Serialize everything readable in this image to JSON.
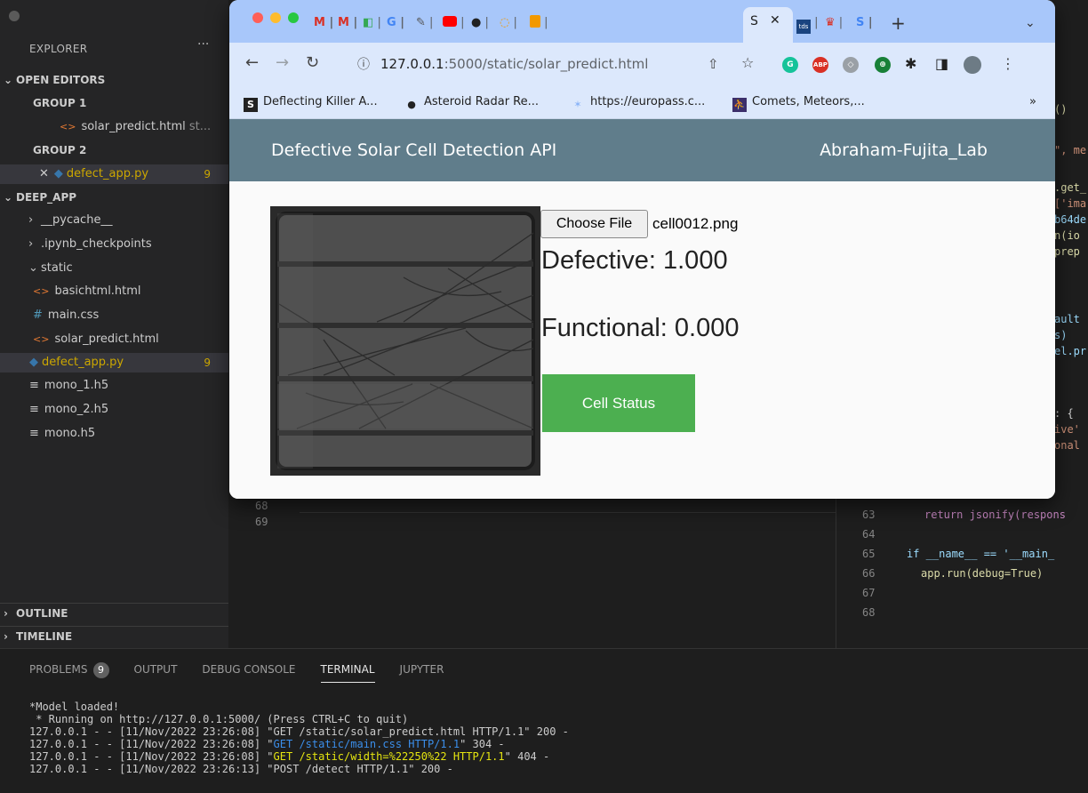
{
  "sidebar": {
    "title": "EXPLORER",
    "more": "···",
    "open_editors": "OPEN EDITORS",
    "group1": "GROUP 1",
    "group1_file": "solar_predict.html",
    "group1_file_suffix": "st...",
    "group2": "GROUP 2",
    "group2_file": "defect_app.py",
    "group2_badge": "9",
    "folder": "DEEP_APP",
    "items": [
      {
        "label": "__pycache__"
      },
      {
        "label": ".ipynb_checkpoints"
      },
      {
        "label": "static"
      },
      {
        "label": "basichtml.html"
      },
      {
        "label": "main.css"
      },
      {
        "label": "solar_predict.html"
      },
      {
        "label": "defect_app.py",
        "badge": "9"
      },
      {
        "label": "mono_1.h5"
      },
      {
        "label": "mono_2.h5"
      },
      {
        "label": "mono.h5"
      }
    ],
    "outline": "OUTLINE",
    "timeline": "TIMELINE"
  },
  "editor": {
    "left_lines": [
      "68",
      "69"
    ],
    "right_frags": [
      "()",
      "\", me",
      ".get_",
      "['ima",
      "b64de",
      "n(io",
      " prep",
      "ault",
      "s)",
      "el.pr",
      ": {",
      "ive'",
      "onal"
    ],
    "right_code": [
      {
        "num": "63",
        "text": "return jsonify(respons"
      },
      {
        "num": "64",
        "text": ""
      },
      {
        "num": "65",
        "text": "if __name__ == '__main_"
      },
      {
        "num": "66",
        "text": "app.run(debug=True)"
      },
      {
        "num": "67",
        "text": ""
      },
      {
        "num": "68",
        "text": ""
      }
    ]
  },
  "panel": {
    "tabs": [
      "PROBLEMS",
      "OUTPUT",
      "DEBUG CONSOLE",
      "TERMINAL",
      "JUPYTER"
    ],
    "problems_count": "9",
    "terminal": {
      "line1": "*Model loaded!",
      "line2": " * Running on http://127.0.0.1:5000/ (Press CTRL+C to quit)",
      "line3_pre": "127.0.0.1 - - [11/Nov/2022 23:26:08] \"GET /static/solar_predict.html HTTP/1.1\" 200 -",
      "line4_pre": "127.0.0.1 - - [11/Nov/2022 23:26:08] \"",
      "line4_blue": "GET /static/main.css HTTP/1.1",
      "line4_post": "\" 304 -",
      "line5_pre": "127.0.0.1 - - [11/Nov/2022 23:26:08] \"",
      "line5_yellow": "GET /static/width=%22250%22 HTTP/1.1",
      "line5_post": "\" 404 -",
      "line6": "127.0.0.1 - - [11/Nov/2022 23:26:13] \"POST /detect HTTP/1.1\" 200 -"
    }
  },
  "browser": {
    "tabs_mini": [
      "M",
      "M",
      "G",
      "S"
    ],
    "active_tab_label": "S",
    "new_tab": "+",
    "tab_menu": "⌄",
    "url_host": "127.0.0.1",
    "url_path": ":5000/static/solar_predict.html",
    "bookmarks": [
      {
        "label": "Deflecting Killer A..."
      },
      {
        "label": "Asteroid Radar Re..."
      },
      {
        "label": "https://europass.c..."
      },
      {
        "label": "Comets, Meteors,..."
      }
    ],
    "bookmarks_more": "»"
  },
  "page": {
    "title": "Defective Solar Cell Detection API",
    "lab": "Abraham-Fujita_Lab",
    "choose_file": "Choose File",
    "file_name": "cell0012.png",
    "defective_label": "Defective: 1.000",
    "functional_label": "Functional: 0.000",
    "status_button": "Cell Status"
  },
  "colors": {
    "header": "#607d8b",
    "status_button": "#4caf50",
    "tabstrip": "#a8c7fa"
  }
}
